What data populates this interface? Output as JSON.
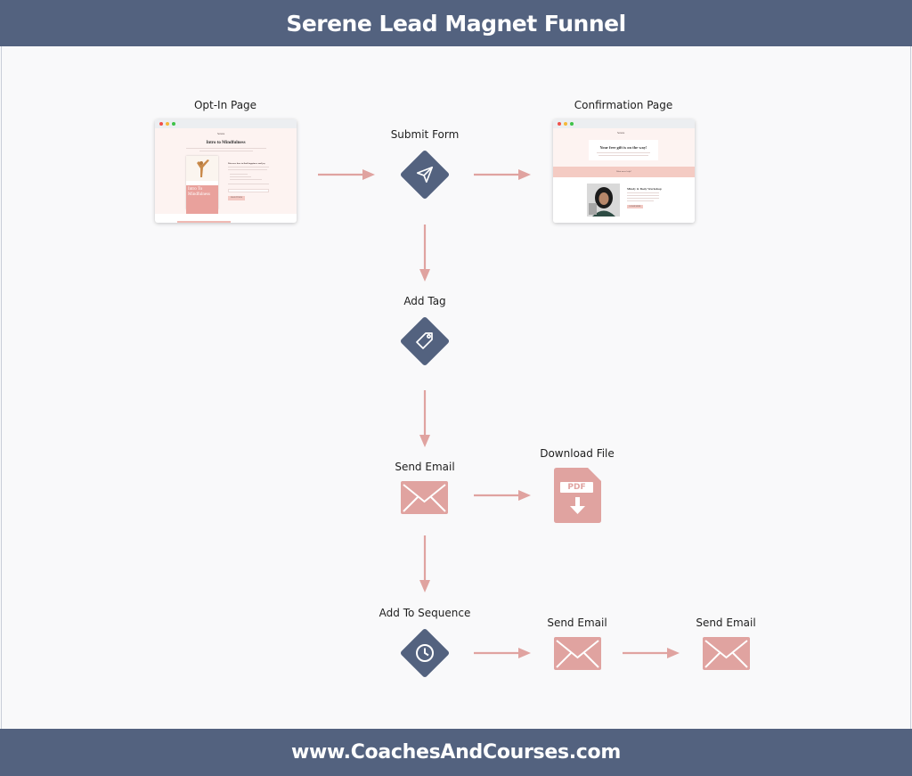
{
  "header": {
    "title": "Serene Lead Magnet Funnel"
  },
  "footer": {
    "url_text": "www.CoachesAndCourses.com"
  },
  "colors": {
    "banner": "#53627f",
    "node": "#53627f",
    "accent": "#e0a3a0",
    "background": "#f9f9fa"
  },
  "nodes": {
    "optin": {
      "label": "Opt-In Page",
      "type": "page-thumbnail"
    },
    "submit": {
      "label": "Submit Form",
      "icon": "send-icon"
    },
    "confirm": {
      "label": "Confirmation Page",
      "type": "page-thumbnail"
    },
    "tag": {
      "label": "Add Tag",
      "icon": "tag-icon"
    },
    "email1": {
      "label": "Send Email",
      "icon": "envelope-icon"
    },
    "download": {
      "label": "Download File",
      "icon": "pdf-download-icon",
      "badge": "PDF"
    },
    "sequence": {
      "label": "Add To Sequence",
      "icon": "clock-icon"
    },
    "email2": {
      "label": "Send Email",
      "icon": "envelope-icon"
    },
    "email3": {
      "label": "Send Email",
      "icon": "envelope-icon"
    }
  },
  "edges": [
    [
      "optin",
      "submit"
    ],
    [
      "submit",
      "confirm"
    ],
    [
      "submit",
      "tag"
    ],
    [
      "tag",
      "email1"
    ],
    [
      "email1",
      "download"
    ],
    [
      "email1",
      "sequence"
    ],
    [
      "sequence",
      "email2"
    ],
    [
      "email2",
      "email3"
    ]
  ],
  "optin_thumb": {
    "brand": "Serene",
    "title": "Intro to Mindfulness",
    "book_title": "Intro To Mindfulness",
    "subhead": "Discover how to find happiness and joy",
    "button": "GRAB IT NOW"
  },
  "confirm_thumb": {
    "brand": "Serene",
    "title": "Your free gift is on the way!",
    "band_text": "Want more help?",
    "workshop_title": "Mindy & Body Workshop",
    "button": "LEARN MORE"
  }
}
